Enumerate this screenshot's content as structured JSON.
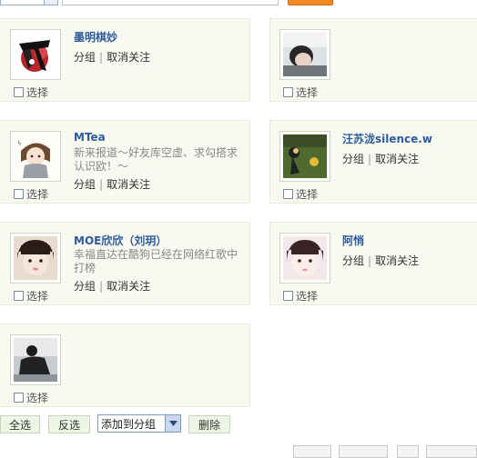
{
  "users": [
    {
      "name": "墨明棋妙",
      "desc": "",
      "group_link": "分组",
      "unfollow_link": "取消关注",
      "select_label": "选择"
    },
    {
      "name": "",
      "desc": "",
      "group_link": "",
      "unfollow_link": "",
      "select_label": "选择"
    },
    {
      "name": "MTea",
      "desc": "新来报道～好友库空虚、求勾搭求认识欧！～",
      "group_link": "分组",
      "unfollow_link": "取消关注",
      "select_label": "选择"
    },
    {
      "name": "汪苏泷silence.w",
      "desc": "",
      "group_link": "分组",
      "unfollow_link": "取消关注",
      "select_label": "选择"
    },
    {
      "name": "MOE欣欣（刘玥）",
      "desc": "幸福直达在酷狗已经在网络红歌中打榜",
      "group_link": "分组",
      "unfollow_link": "取消关注",
      "select_label": "选择"
    },
    {
      "name": "阿悄",
      "desc": "",
      "group_link": "分组",
      "unfollow_link": "取消关注",
      "select_label": "选择"
    },
    {
      "name": "",
      "desc": "",
      "group_link": "",
      "unfollow_link": "",
      "select_label": "选择"
    }
  ],
  "separator": "|",
  "footer": {
    "select_all": "全选",
    "invert_select": "反选",
    "add_to_group": "添加到分组",
    "delete": "删除"
  },
  "colors": {
    "name_link": "#2e5b9a",
    "card_bg": "#f8faf1",
    "accent_orange": "#f08a24"
  }
}
